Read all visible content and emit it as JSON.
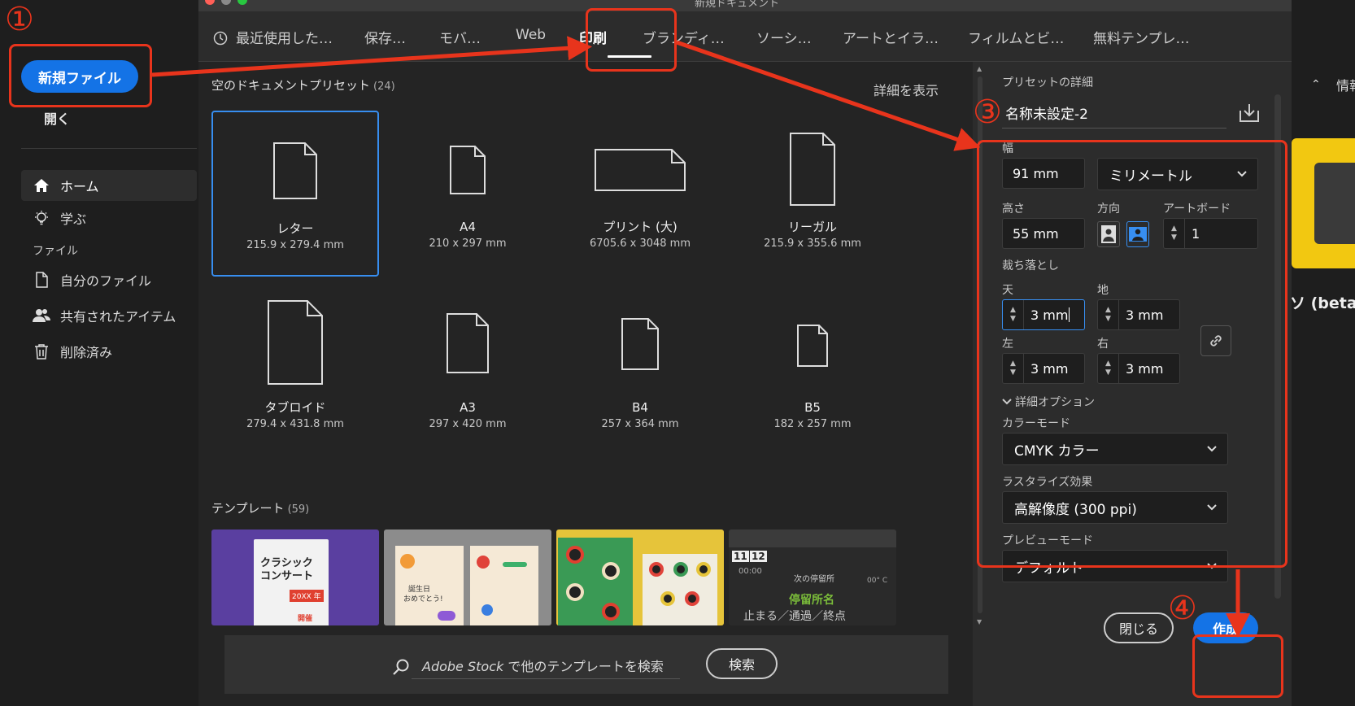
{
  "app": {
    "new_file": "新規ファイル",
    "open": "開く",
    "nav": {
      "home": "ホーム",
      "learn": "学ぶ",
      "files_section": "ファイル",
      "my_files": "自分のファイル",
      "shared": "共有されたアイテム",
      "deleted": "削除済み"
    },
    "right_bg": {
      "info": "情報",
      "beta": "ソ (beta)"
    }
  },
  "dialog": {
    "title": "新規ドキュメント",
    "tabs": [
      {
        "label": "最近使用した…"
      },
      {
        "label": "保存…"
      },
      {
        "label": "モバ…"
      },
      {
        "label": "Web"
      },
      {
        "label": "印刷"
      },
      {
        "label": "ブランディ…"
      },
      {
        "label": "ソーシ…"
      },
      {
        "label": "アートとイラ…"
      },
      {
        "label": "フィルムとビ…"
      },
      {
        "label": "無料テンプレ…"
      }
    ],
    "presets_title": "空のドキュメントプリセット",
    "presets_count": "(24)",
    "show_details": "詳細を表示",
    "presets": [
      {
        "name": "レター",
        "size": "215.9 x 279.4 mm"
      },
      {
        "name": "A4",
        "size": "210 x 297 mm"
      },
      {
        "name": "プリント (大)",
        "size": "6705.6 x 3048 mm"
      },
      {
        "name": "リーガル",
        "size": "215.9 x 355.6 mm"
      },
      {
        "name": "タブロイド",
        "size": "279.4 x 431.8 mm"
      },
      {
        "name": "A3",
        "size": "297 x 420 mm"
      },
      {
        "name": "B4",
        "size": "257 x 364 mm"
      },
      {
        "name": "B5",
        "size": "182 x 257 mm"
      }
    ],
    "templates_title": "テンプレート",
    "templates_count": "(59)",
    "templates": [
      {
        "text1": "クラシック",
        "text2": "コンサート",
        "text3": "20XX 年",
        "text4": "開催"
      },
      {
        "text1": "誕生日",
        "text2": "おめでとう!"
      },
      {},
      {
        "num1": "11",
        "num2": "12",
        "line1": "次の停留所",
        "line2": "停留所名",
        "line3": "止まる／通過／終点",
        "time": "00:00",
        "temp": "00° C"
      }
    ],
    "search_stock": "Adobe Stock",
    "search_rest": " で他のテンプレートを検索",
    "search_button": "検索"
  },
  "details": {
    "heading": "プリセットの詳細",
    "doc_name": "名称未設定-2",
    "width_label": "幅",
    "width_value": "91 mm",
    "unit": "ミリメートル",
    "height_label": "高さ",
    "height_value": "55 mm",
    "orientation_label": "方向",
    "artboard_label": "アートボード",
    "artboard_value": "1",
    "bleed_label": "裁ち落とし",
    "top_label": "天",
    "top_value": "3 mm",
    "bottom_label": "地",
    "bottom_value": "3 mm",
    "left_label": "左",
    "left_value": "3 mm",
    "right_label": "右",
    "right_value": "3 mm",
    "advanced": "詳細オプション",
    "color_mode_label": "カラーモード",
    "color_mode_value": "CMYK カラー",
    "raster_label": "ラスタライズ効果",
    "raster_value": "高解像度 (300 ppi)",
    "preview_label": "プレビューモード",
    "preview_value": "デフォルト",
    "close_button": "閉じる",
    "create_button": "作成"
  },
  "annotations": {
    "step1": "①",
    "step3": "③",
    "step4": "④"
  },
  "colors": {
    "accent": "#1473e6",
    "annotation": "#e8341c",
    "selection": "#378ef0"
  }
}
